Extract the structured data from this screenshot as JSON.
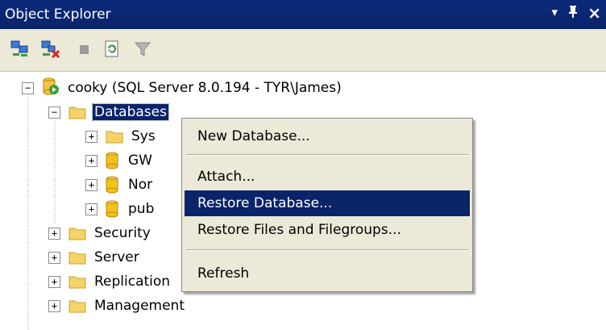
{
  "panel": {
    "title": "Object Explorer",
    "pin_glyph": "ф",
    "dropdown_glyph": "▾",
    "close_glyph": "×"
  },
  "toolbar": {
    "icons": [
      "connect-icon",
      "disconnect-icon",
      "stop-icon",
      "refresh-icon",
      "filter-icon"
    ]
  },
  "tree": {
    "server": {
      "label": "cooky (SQL Server 8.0.194 - TYR\\James)",
      "expander": "−"
    },
    "databases": {
      "label": "Databases",
      "expander": "−"
    },
    "db_children": [
      {
        "label": "Sys",
        "expander": "+",
        "kind": "folder"
      },
      {
        "label": "GW",
        "expander": "+",
        "kind": "database"
      },
      {
        "label": "Nor",
        "expander": "+",
        "kind": "database"
      },
      {
        "label": "pub",
        "expander": "+",
        "kind": "database"
      }
    ],
    "server_children": [
      {
        "label": "Security",
        "expander": "+"
      },
      {
        "label": "Server",
        "expander": "+"
      },
      {
        "label": "Replication",
        "expander": "+"
      },
      {
        "label": "Management",
        "expander": "+"
      }
    ]
  },
  "context_menu": {
    "items": [
      {
        "label": "New Database..."
      },
      {
        "label": "Attach..."
      },
      {
        "label": "Restore Database...",
        "highlighted": true
      },
      {
        "label": "Restore Files and Filegroups..."
      },
      {
        "label": "Refresh"
      }
    ]
  },
  "colors": {
    "selection": "#0a246a",
    "menu_bg": "#ece9d8",
    "folder": "#f5d36a",
    "database": "#f2c21b"
  }
}
